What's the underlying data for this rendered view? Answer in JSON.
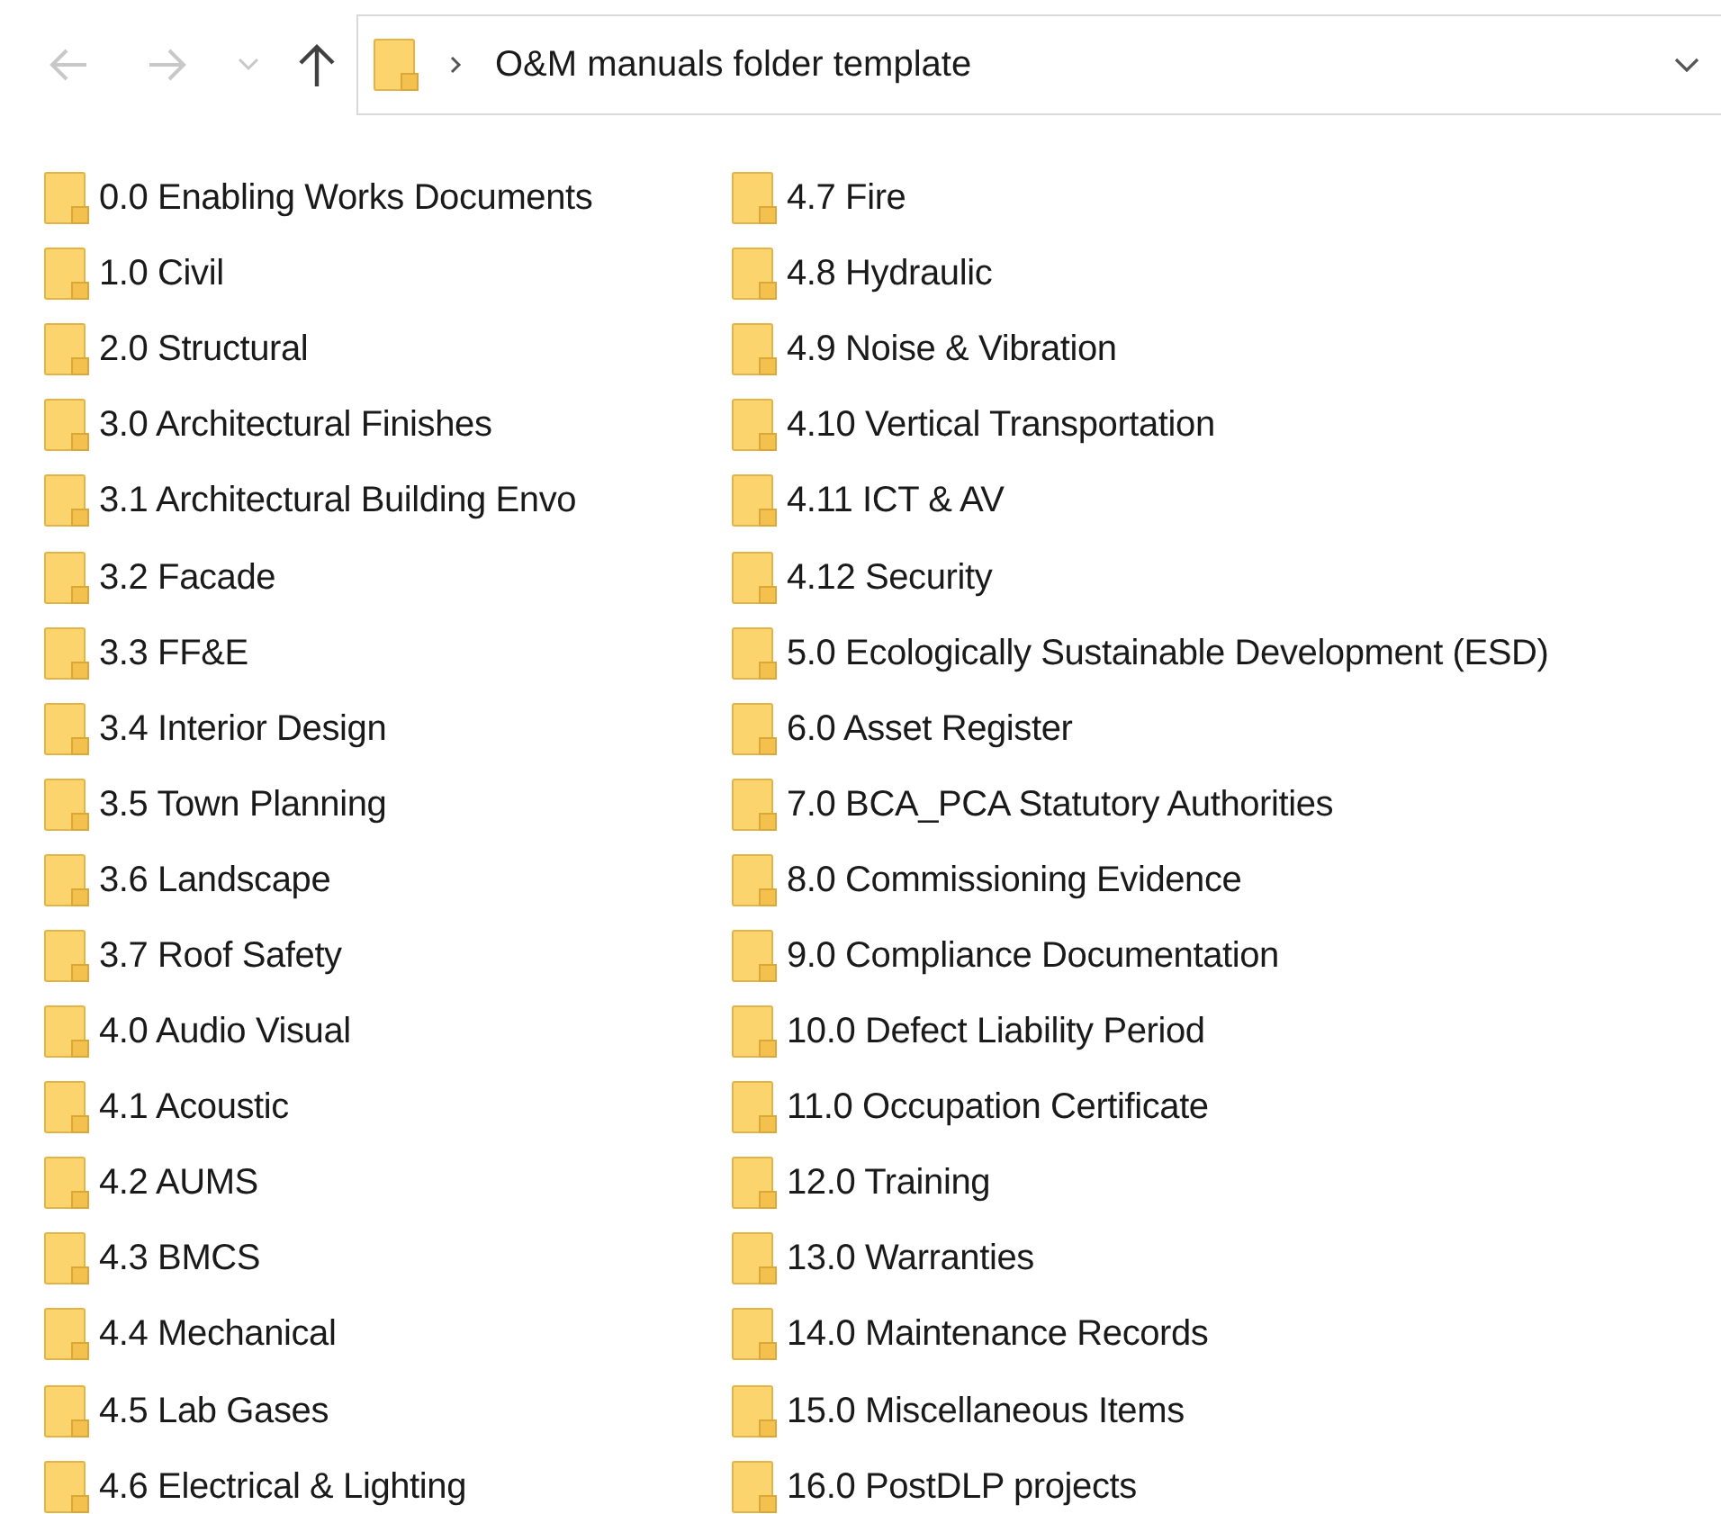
{
  "nav": [
    {
      "kind": "back",
      "disabled": true
    },
    {
      "kind": "forward",
      "disabled": true
    },
    {
      "kind": "recent",
      "disabled": true
    },
    {
      "kind": "up",
      "disabled": false
    }
  ],
  "address_bar": {
    "path": "O&M manuals folder template"
  },
  "folders": [
    [
      "0.0 Enabling Works Documents",
      "1.0 Civil",
      "2.0 Structural",
      "3.0 Architectural Finishes",
      "3.1 Architectural Building Envo",
      "3.2 Facade",
      "3.3 FF&E",
      "3.4 Interior Design",
      "3.5 Town Planning",
      "3.6 Landscape",
      "3.7 Roof Safety",
      "4.0 Audio Visual",
      "4.1 Acoustic",
      "4.2 AUMS",
      "4.3 BMCS",
      "4.4 Mechanical",
      "4.5 Lab Gases",
      "4.6 Electrical & Lighting"
    ],
    [
      "4.7 Fire",
      "4.8 Hydraulic",
      "4.9 Noise & Vibration",
      "4.10 Vertical Transportation",
      "4.11 ICT & AV",
      "4.12 Security",
      "5.0 Ecologically Sustainable Development (ESD)",
      "6.0 Asset Register",
      "7.0 BCA_PCA Statutory Authorities",
      "8.0 Commissioning Evidence",
      "9.0 Compliance Documentation",
      "10.0 Defect Liability Period",
      "11.0 Occupation Certificate",
      "12.0 Training",
      "13.0 Warranties",
      "14.0 Maintenance Records",
      "15.0 Miscellaneous Items",
      "16.0 PostDLP projects"
    ]
  ]
}
